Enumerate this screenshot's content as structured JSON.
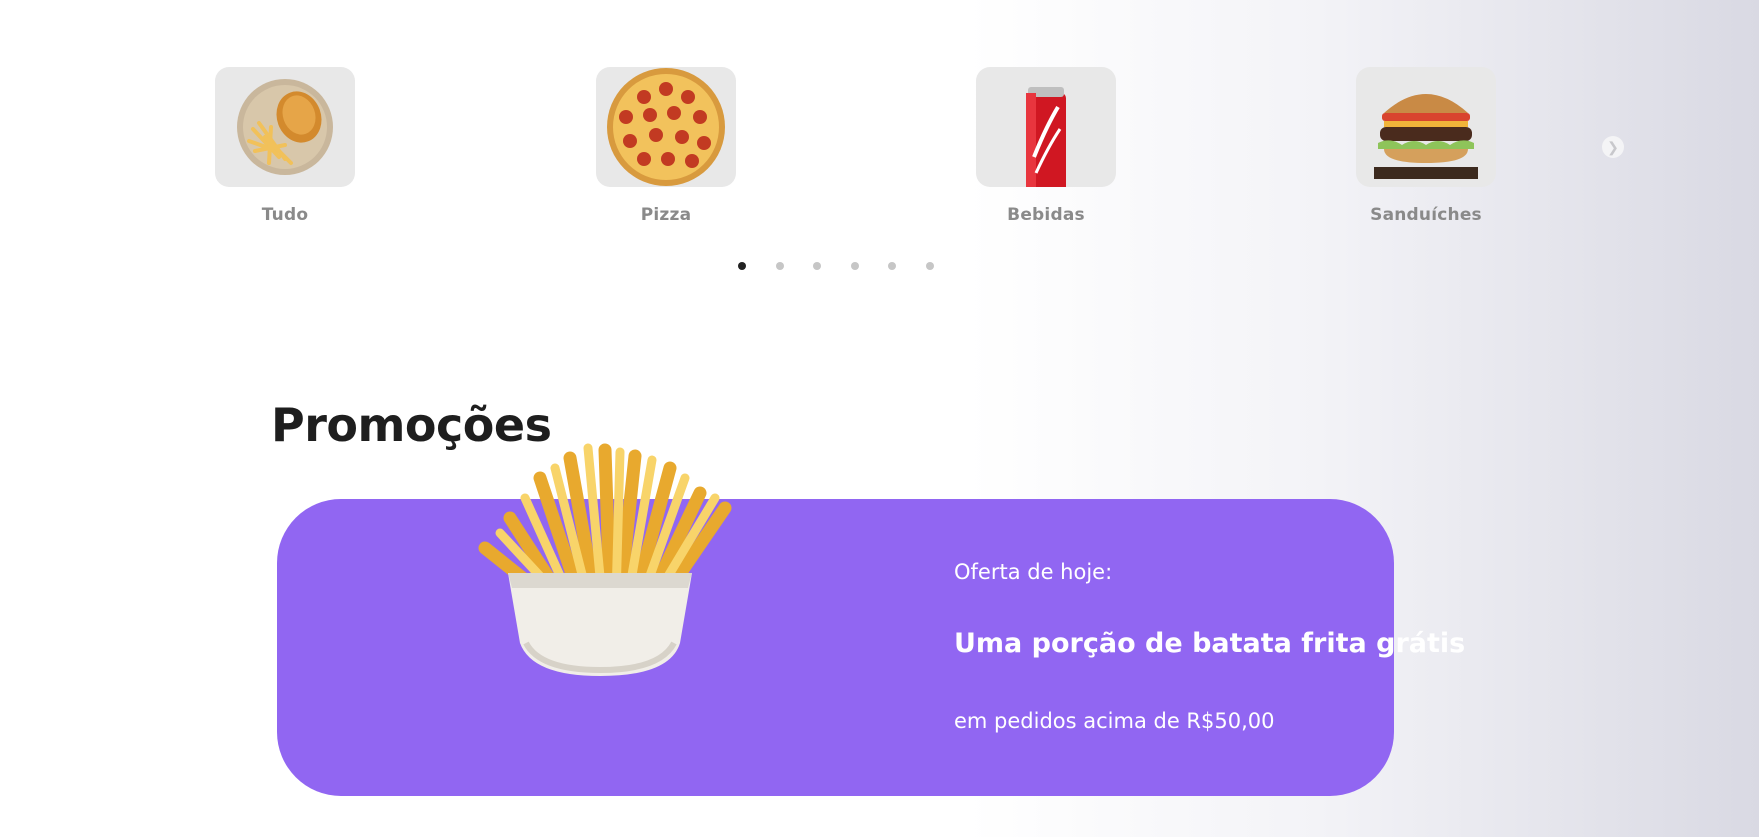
{
  "categories": {
    "items": [
      {
        "label": "Tudo",
        "icon": "fries-plate-icon"
      },
      {
        "label": "Pizza",
        "icon": "pizza-icon"
      },
      {
        "label": "Bebidas",
        "icon": "soda-can-icon"
      },
      {
        "label": "Sanduíches",
        "icon": "burger-icon"
      }
    ],
    "next_icon": "chevron-right-icon",
    "page_count": 6,
    "active_page": 1
  },
  "promotions": {
    "title": "Promoções",
    "kicker": "Oferta de hoje:",
    "headline": "Uma porção de batata frita grátis",
    "subtext": "em pedidos acima de R$50,00",
    "image_icon": "french-fries-icon"
  },
  "colors": {
    "promo_background": "#9166f2",
    "category_label": "#8a8a8a",
    "dot_active": "#222222",
    "dot_inactive": "#c6c6c6"
  }
}
